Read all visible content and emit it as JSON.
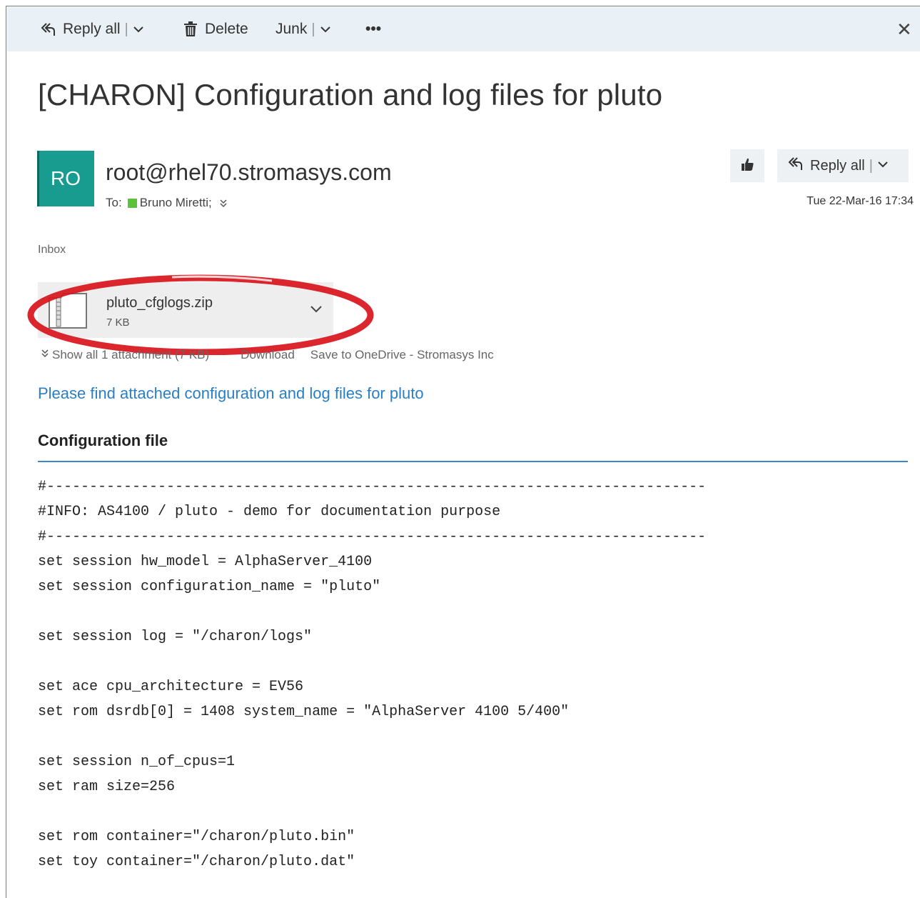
{
  "toolbar": {
    "reply_all": "Reply all",
    "delete": "Delete",
    "junk": "Junk",
    "more": "•••",
    "close": "✕"
  },
  "message": {
    "subject": "[CHARON] Configuration and log files for pluto",
    "avatar_initials": "RO",
    "avatar_color": "#179c8f",
    "sender": "root@rhel70.stromasys.com",
    "to_label": "To:",
    "recipient": "Bruno Miretti;",
    "reply_all": "Reply all",
    "date": "Tue 22-Mar-16 17:34",
    "folder": "Inbox"
  },
  "attachment": {
    "name": "pluto_cfglogs.zip",
    "size": "7 KB",
    "show_all": "Show all 1 attachment (7 KB)",
    "download": "Download",
    "save_onedrive": "Save to OneDrive - Stromasys Inc"
  },
  "body": {
    "intro": "Please find attached configuration and log files for pluto",
    "section_title": "Configuration file",
    "code_lines": [
      "#-----------------------------------------------------------------------------",
      "#INFO: AS4100 / pluto - demo for documentation purpose",
      "#-----------------------------------------------------------------------------",
      "set session hw_model = AlphaServer_4100",
      "set session configuration_name = \"pluto\"",
      "",
      "set session log = \"/charon/logs\"",
      "",
      "set ace cpu_architecture = EV56",
      "set rom dsrdb[0] = 1408 system_name = \"AlphaServer 4100 5/400\"",
      "",
      "set session n_of_cpus=1",
      "set ram size=256",
      "",
      "set rom container=\"/charon/pluto.bin\"",
      "set toy container=\"/charon/pluto.dat\""
    ]
  },
  "colors": {
    "toolbar_bg": "#e9f1f6",
    "link": "#2a7ec4",
    "rule": "#3a86c9",
    "highlight": "#d9141b",
    "presence": "#5cc23a"
  }
}
